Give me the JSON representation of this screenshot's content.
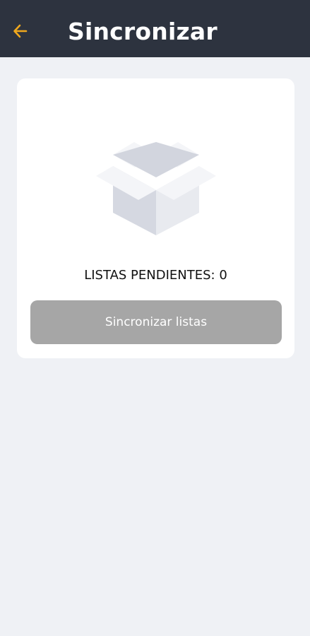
{
  "header": {
    "title": "Sincronizar",
    "back_icon": "arrow-left-icon",
    "back_icon_color": "#f0a81d",
    "background": "#2d333f"
  },
  "sync_card": {
    "empty_state_icon": "open-box-icon",
    "pending_label": "LISTAS PENDIENTES: 0",
    "sync_button_label": "Sincronizar listas",
    "button_color": "#a6a6a6"
  }
}
